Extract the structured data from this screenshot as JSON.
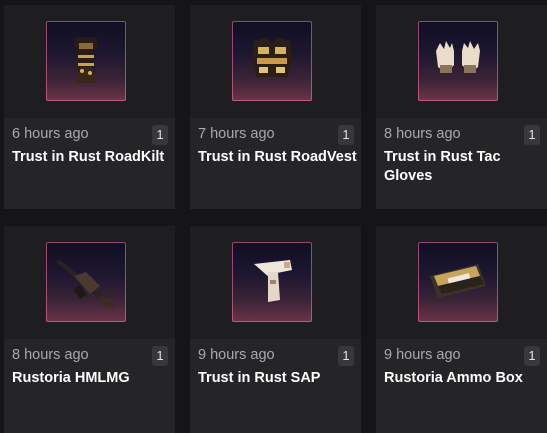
{
  "items": [
    {
      "time": "6 hours ago",
      "count": "1",
      "name": "Trust in Rust RoadKilt",
      "icon": "roadkilt-icon"
    },
    {
      "time": "7 hours ago",
      "count": "1",
      "name": "Trust in Rust RoadVest",
      "icon": "roadvest-icon"
    },
    {
      "time": "8 hours ago",
      "count": "1",
      "name": "Trust in Rust Tac Gloves",
      "icon": "tactical-gloves-icon"
    },
    {
      "time": "8 hours ago",
      "count": "1",
      "name": "Rustoria HMLMG",
      "icon": "hmlmg-icon"
    },
    {
      "time": "9 hours ago",
      "count": "1",
      "name": "Trust in Rust SAP",
      "icon": "sap-pistol-icon"
    },
    {
      "time": "9 hours ago",
      "count": "1",
      "name": "Rustoria Ammo Box",
      "icon": "ammo-box-icon"
    }
  ],
  "colors": {
    "card": "#252528",
    "thumb_border": "#ff78aa"
  }
}
